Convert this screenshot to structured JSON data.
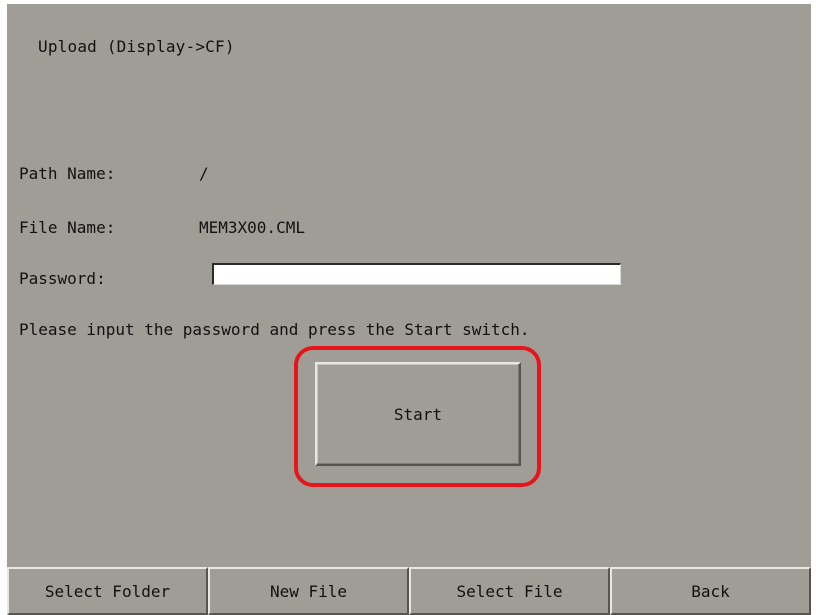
{
  "screen": {
    "title": "Upload (Display->CF)"
  },
  "fields": {
    "path_label": "Path Name:",
    "path_value": "/",
    "file_label": "File Name:",
    "file_value": "MEM3X00.CML",
    "password_label": "Password:",
    "password_value": ""
  },
  "instruction": "Please input the password and press the Start switch.",
  "start_button": {
    "label": "Start",
    "highlight_color": "#e8141b"
  },
  "bottom_bar": {
    "buttons": [
      {
        "label": "Select Folder"
      },
      {
        "label": "New File"
      },
      {
        "label": "Select File"
      },
      {
        "label": "Back"
      }
    ]
  },
  "colors": {
    "panel_background": "#a09d97",
    "text": "#111111"
  }
}
